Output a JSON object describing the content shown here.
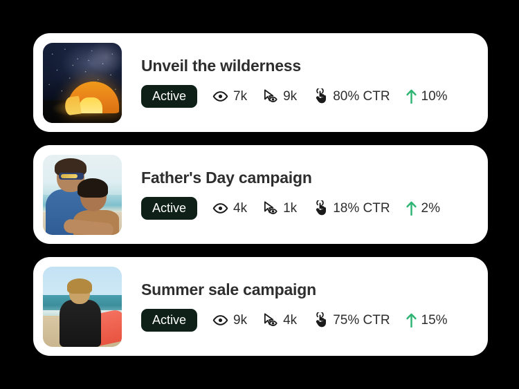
{
  "background_color": "#000000",
  "card_background": "#ffffff",
  "accent_colors": {
    "badge_background": "#0e2018",
    "badge_text": "#ffffff",
    "trend_up": "#2fb573",
    "title_text": "#2e2e2e",
    "metric_text": "#2d2d2d"
  },
  "campaigns": [
    {
      "title": "Unveil the wilderness",
      "thumbnail_alt": "night sky with glowing orange tent",
      "status": "Active",
      "metrics": {
        "views_icon": "eye-icon",
        "views": "7k",
        "impressions_icon": "cursor-eye-icon",
        "impressions": "9k",
        "ctr_icon": "tap-hand-icon",
        "ctr": "80% CTR",
        "trend_icon": "arrow-up-icon",
        "trend": "10%"
      }
    },
    {
      "title": "Father's Day campaign",
      "thumbnail_alt": "father and son at the beach",
      "status": "Active",
      "metrics": {
        "views_icon": "eye-icon",
        "views": "4k",
        "impressions_icon": "cursor-eye-icon",
        "impressions": "1k",
        "ctr_icon": "tap-hand-icon",
        "ctr": "18% CTR",
        "trend_icon": "arrow-up-icon",
        "trend": "2%"
      }
    },
    {
      "title": "Summer sale campaign",
      "thumbnail_alt": "surfer carrying red surfboard on beach",
      "status": "Active",
      "metrics": {
        "views_icon": "eye-icon",
        "views": "9k",
        "impressions_icon": "cursor-eye-icon",
        "impressions": "4k",
        "ctr_icon": "tap-hand-icon",
        "ctr": "75% CTR",
        "trend_icon": "arrow-up-icon",
        "trend": "15%"
      }
    }
  ]
}
